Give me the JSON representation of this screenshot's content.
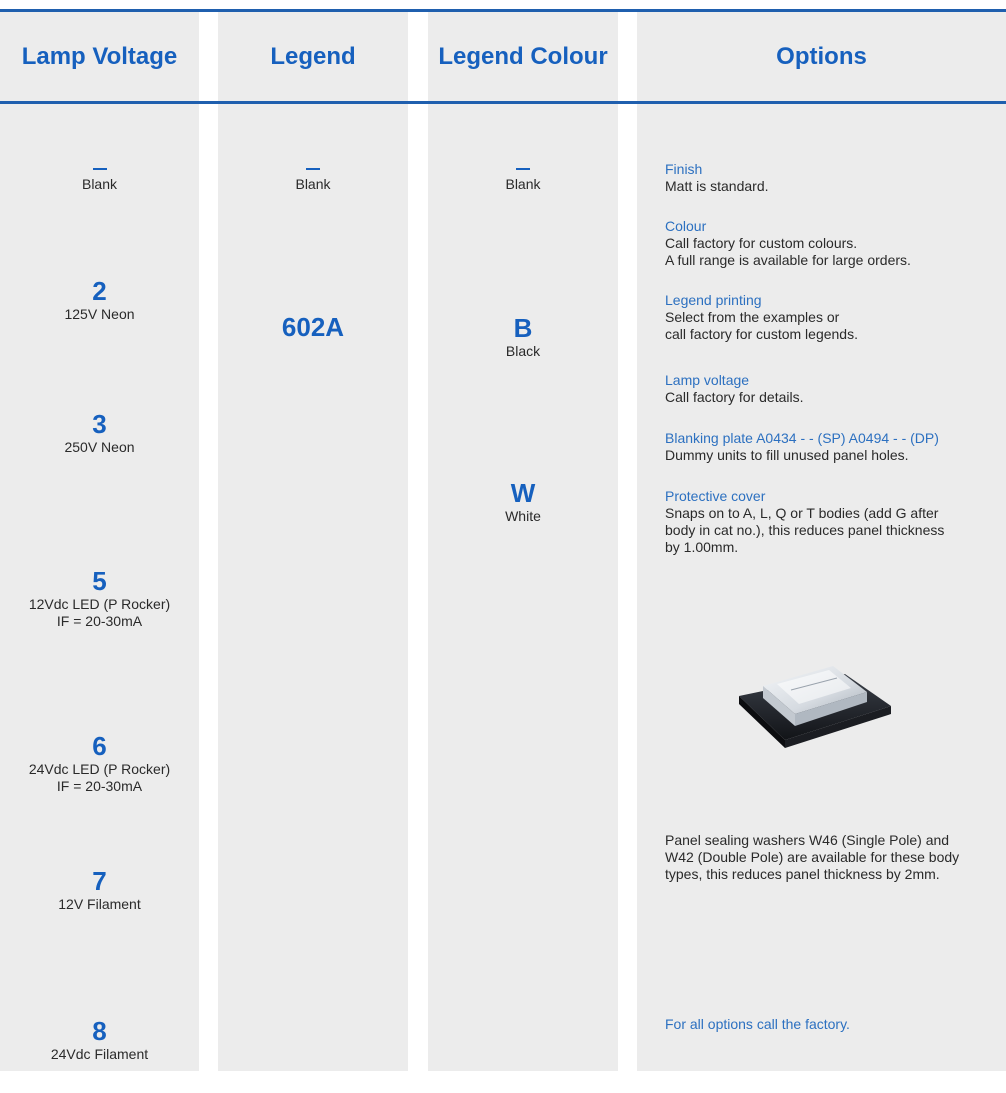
{
  "headers": {
    "lamp_voltage": "Lamp Voltage",
    "legend": "Legend",
    "legend_colour": "Legend Colour",
    "options": "Options"
  },
  "lamp_voltage": [
    {
      "code": "",
      "desc": "Blank",
      "blank": true
    },
    {
      "code": "2",
      "desc": "125V Neon"
    },
    {
      "code": "3",
      "desc": "250V Neon"
    },
    {
      "code": "5",
      "desc": "12Vdc LED (P Rocker)",
      "desc2": "IF = 20-30mA"
    },
    {
      "code": "6",
      "desc": "24Vdc LED (P Rocker)",
      "desc2": "IF = 20-30mA"
    },
    {
      "code": "7",
      "desc": "12V Filament"
    },
    {
      "code": "8",
      "desc": "24Vdc Filament"
    }
  ],
  "legend": [
    {
      "code": "",
      "desc": "Blank",
      "blank": true
    },
    {
      "code": "602A",
      "desc": ""
    }
  ],
  "legend_colour": [
    {
      "code": "",
      "desc": "Blank",
      "blank": true
    },
    {
      "code": "B",
      "desc": "Black"
    },
    {
      "code": "W",
      "desc": "White"
    }
  ],
  "options": {
    "finish": {
      "title": "Finish",
      "body": "Matt is standard."
    },
    "colour": {
      "title": "Colour",
      "body1": "Call factory for custom colours.",
      "body2": "A full range is available for large orders."
    },
    "legend_printing": {
      "title": "Legend printing",
      "body1": "Select from the examples or",
      "body2": "call factory for custom legends."
    },
    "lamp_voltage": {
      "title": "Lamp voltage",
      "body": "Call factory for details."
    },
    "blanking_plate": {
      "title": "Blanking plate A0434 - - (SP) A0494 - - (DP)",
      "body": "Dummy units to fill unused panel holes."
    },
    "protective_cover": {
      "title": "Protective cover",
      "body1": "Snaps on to A, L, Q or T bodies (add G after",
      "body2": "body in cat no.), this reduces panel thickness",
      "body3": "by 1.00mm."
    },
    "sealing_washers": {
      "line1": "Panel sealing washers W46 (Single Pole) and",
      "line2": "W42 (Double Pole) are available for these body",
      "line3": "types, this reduces panel thickness by 2mm."
    },
    "footer": "For all options call the factory."
  },
  "colors": {
    "accent": "#1660be",
    "link": "#2c70c0",
    "rule": "#1f5fae",
    "column_bg": "#ececec"
  }
}
